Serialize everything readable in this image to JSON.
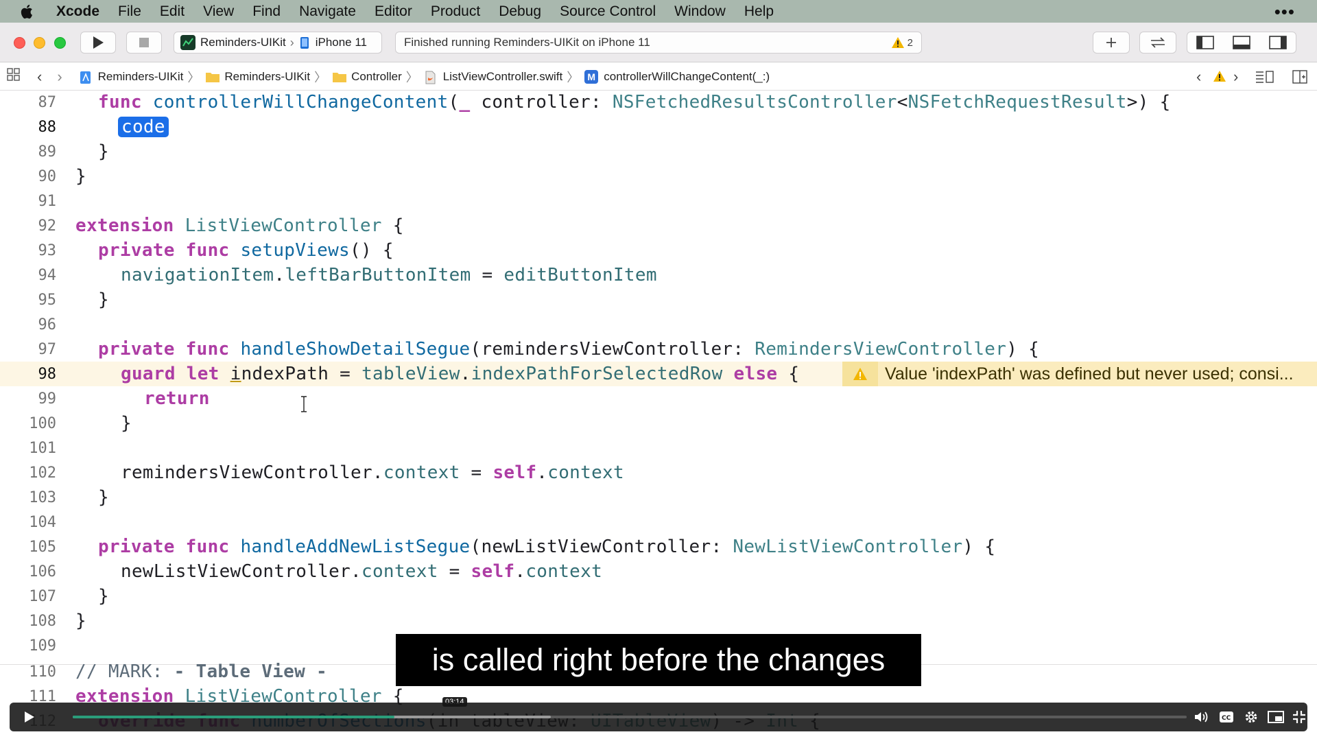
{
  "menubar": {
    "app_name": "Xcode",
    "items": [
      "File",
      "Edit",
      "View",
      "Find",
      "Navigate",
      "Editor",
      "Product",
      "Debug",
      "Source Control",
      "Window",
      "Help"
    ],
    "overflow": "•••"
  },
  "toolbar": {
    "scheme": "Reminders-UIKit",
    "destination": "iPhone 11",
    "status": "Finished running Reminders-UIKit on iPhone 11",
    "warning_count": "2"
  },
  "jumpbar": {
    "crumbs": [
      "Reminders-UIKit",
      "Reminders-UIKit",
      "Controller",
      "ListViewController.swift",
      "controllerWillChangeContent(_:)"
    ],
    "symbol_badge": "M"
  },
  "editor": {
    "line_numbers": [
      "87",
      "88",
      "89",
      "90",
      "91",
      "92",
      "93",
      "94",
      "95",
      "96",
      "97",
      "98",
      "99",
      "100",
      "101",
      "102",
      "103",
      "104",
      "105",
      "106",
      "107",
      "108",
      "109",
      "110",
      "111",
      "112"
    ],
    "placeholder": "code",
    "issue_message": "Value 'indexPath' was defined but never used; consi..."
  },
  "subtitle": "is called right before the changes",
  "video": {
    "timestamp": "03:14",
    "progress_fraction": 0.289,
    "buffered_fraction": 0.429
  },
  "colors": {
    "keyword": "#ad3da4",
    "function": "#0f68a0",
    "type": "#3e8087",
    "highlight_line": "#fdf6e4",
    "warning": "#fbecbe",
    "progress": "#2a9d7a"
  }
}
